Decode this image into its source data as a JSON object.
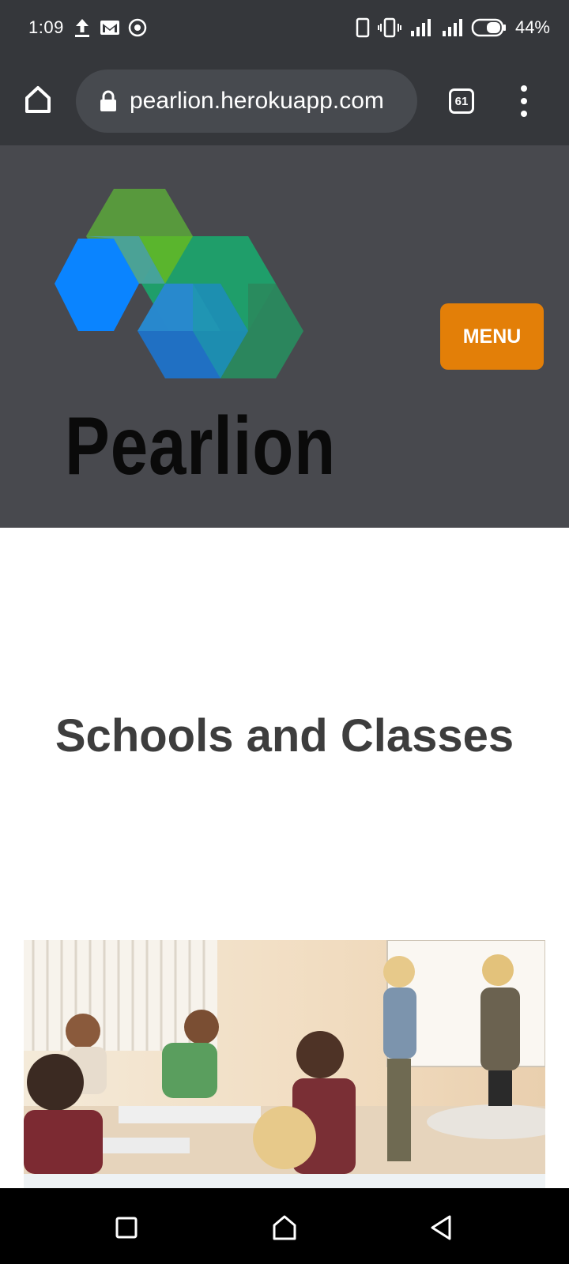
{
  "status_bar": {
    "time": "1:09",
    "battery": "44%",
    "left_icons": [
      "upload-icon",
      "gmail-icon",
      "target-icon"
    ],
    "right_icons": [
      "phone-outline-icon",
      "vibrate-icon",
      "signal-icon",
      "signal-icon",
      "battery-icon"
    ]
  },
  "browser": {
    "url": "pearlion.herokuapp.com",
    "tab_count": "61"
  },
  "header": {
    "logo_text": "Pearlion",
    "menu_label": "MENU",
    "menu_color": "#e37f08"
  },
  "main": {
    "title": "Schools and Classes"
  }
}
